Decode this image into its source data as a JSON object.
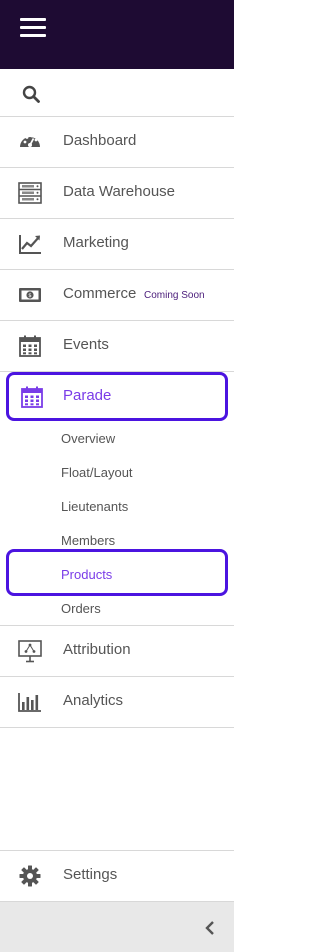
{
  "header": {
    "menu_icon": "hamburger-icon",
    "bg_color": "#1e0b33"
  },
  "search": {
    "icon": "search-icon"
  },
  "nav": {
    "dashboard": {
      "label": "Dashboard",
      "icon": "speedometer-icon"
    },
    "data_warehouse": {
      "label": "Data Warehouse",
      "icon": "server-icon"
    },
    "marketing": {
      "label": "Marketing",
      "icon": "line-chart-icon"
    },
    "commerce": {
      "label": "Commerce",
      "icon": "banknote-icon",
      "badge": "Coming Soon"
    },
    "events": {
      "label": "Events",
      "icon": "calendar-icon"
    },
    "parade": {
      "label": "Parade",
      "icon": "calendar-icon",
      "submenu": [
        "Overview",
        "Float/Layout",
        "Lieutenants",
        "Members",
        "Products",
        "Orders"
      ],
      "active_submenu": "Products"
    },
    "attribution": {
      "label": "Attribution",
      "icon": "presentation-icon"
    },
    "analytics": {
      "label": "Analytics",
      "icon": "bar-chart-icon"
    },
    "settings": {
      "label": "Settings",
      "icon": "gear-icon"
    }
  },
  "footer": {
    "collapse_icon": "chevron-left-icon"
  },
  "colors": {
    "accent": "#7a3ce8",
    "highlight_border": "#4b14e0",
    "badge_text": "#4a1c7a"
  }
}
